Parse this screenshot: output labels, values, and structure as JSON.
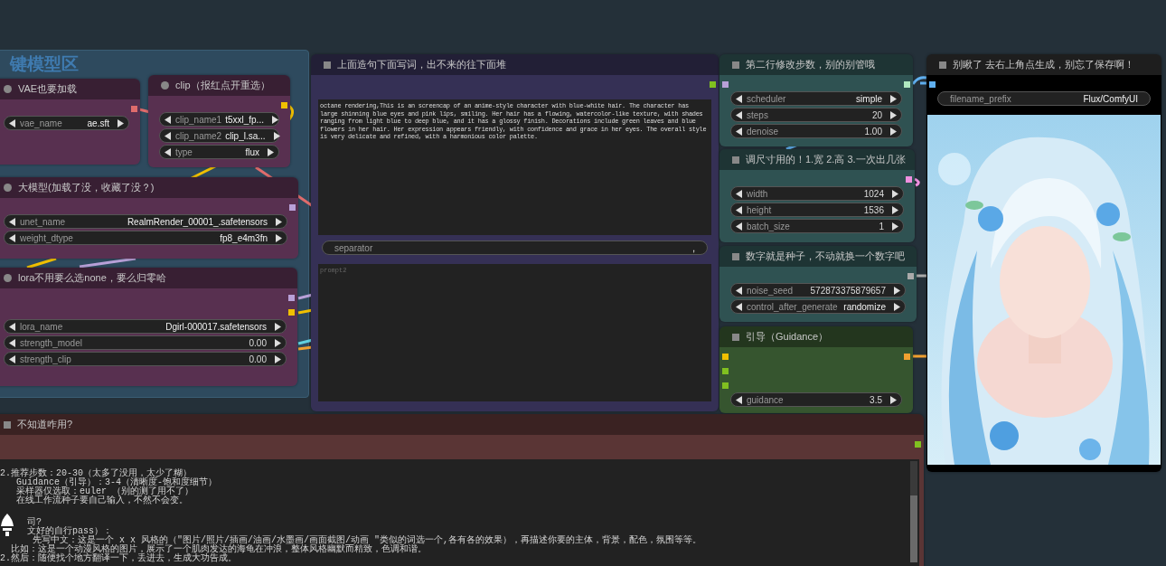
{
  "group": {
    "title": "键模型区"
  },
  "nodes": [
    {
      "kind": "widgets",
      "badge": {
        "kind": "dot"
      },
      "title": "VAE也要加载",
      "color": "#583050",
      "outputs": [
        {
          "color": "#e06c6c"
        }
      ],
      "widgets": [
        {
          "kind": "combo",
          "label": "vae_name",
          "value": "ae.sft"
        }
      ]
    },
    {
      "kind": "widgets",
      "badge": {
        "kind": "dot"
      },
      "title": "clip（报红点开重选）",
      "color": "#583050",
      "outputs": [
        {
          "color": "#f0c000"
        }
      ],
      "widgets": [
        {
          "kind": "combo",
          "label": "clip_name1",
          "value": "t5xxl_fp..."
        },
        {
          "kind": "combo",
          "label": "clip_name2",
          "value": "clip_l.sa..."
        },
        {
          "kind": "combo",
          "label": "type",
          "value": "flux"
        }
      ]
    },
    {
      "kind": "widgets",
      "badge": {
        "kind": "dot"
      },
      "title": "大模型(加载了没，收藏了没？)",
      "color": "#583050",
      "outputs": [
        {
          "color": "#b8a0d8"
        }
      ],
      "widgets": [
        {
          "kind": "combo",
          "label": "unet_name",
          "value": "RealmRender_00001_.safetensors"
        },
        {
          "kind": "combo",
          "label": "weight_dtype",
          "value": "fp8_e4m3fn"
        }
      ]
    },
    {
      "kind": "widgets",
      "badge": {
        "kind": "dot"
      },
      "title": "lora不用要么选none，要么归零哈",
      "color": "#583050",
      "outputs": [
        {
          "color": "#b8a0d8"
        },
        {
          "color": "#f0c000"
        }
      ],
      "widgets": [
        {
          "kind": "combo",
          "label": "lora_name",
          "value": "Dgirl-000017.safetensors"
        },
        {
          "kind": "number",
          "label": "strength_model",
          "value": "0.00"
        },
        {
          "kind": "number",
          "label": "strength_clip",
          "value": "0.00"
        }
      ]
    },
    {
      "kind": "prompt",
      "badge": {
        "kind": "square"
      },
      "title": "上面造句下面写词，出不来的往下面堆",
      "color": "#353055",
      "outputs": [
        {
          "color": "#80c020"
        }
      ],
      "text": "octane rendering,This is an screencap of an anime-style character with blue-white hair. The character has large shinning blue eyes and pink lips, smiling. Her hair has a flowing, watercolor-like texture, with shades ranging from light blue to deep blue, and it has a glossy finish. Decorations include green leaves and blue flowers in her hair. Her expression appears friendly, with confidence and grace in her eyes. The overall style is very delicate and refined, with a harmonious color palette.",
      "widgets": [
        {
          "kind": "text",
          "label": "separator",
          "value": ","
        }
      ],
      "placeholder": "prompt2"
    },
    {
      "kind": "widgets",
      "badge": {
        "kind": "square"
      },
      "title": "第二行修改步数，别的别管哦",
      "color": "#2f5252",
      "inputs": [
        {
          "color": "#b8a0d8"
        }
      ],
      "outputs": [
        {
          "color": "#b0e8c0"
        }
      ],
      "widgets": [
        {
          "kind": "combo",
          "label": "scheduler",
          "value": "simple"
        },
        {
          "kind": "number",
          "label": "steps",
          "value": "20"
        },
        {
          "kind": "number",
          "label": "denoise",
          "value": "1.00"
        }
      ]
    },
    {
      "kind": "widgets",
      "badge": {
        "kind": "square"
      },
      "title": "调尺寸用的！1.宽 2.高 3.一次出几张",
      "color": "#2f5252",
      "outputs": [
        {
          "color": "#f090e0"
        }
      ],
      "widgets": [
        {
          "kind": "number",
          "label": "width",
          "value": "1024"
        },
        {
          "kind": "number",
          "label": "height",
          "value": "1536"
        },
        {
          "kind": "number",
          "label": "batch_size",
          "value": "1"
        }
      ]
    },
    {
      "kind": "widgets",
      "badge": {
        "kind": "square"
      },
      "title": "数字就是种子，不动就换一个数字吧",
      "color": "#2f5252",
      "outputs": [
        {
          "color": "#aaaaaa"
        }
      ],
      "widgets": [
        {
          "kind": "number",
          "label": "noise_seed",
          "value": "572873375879657"
        },
        {
          "kind": "combo",
          "label": "control_after_generate",
          "value": "randomize"
        }
      ]
    },
    {
      "kind": "widgets",
      "badge": {
        "kind": "square"
      },
      "title": "引导（Guidance）",
      "color": "#36552f",
      "inputs": [
        {
          "color": "#f0c000"
        },
        {
          "color": "#80c020"
        },
        {
          "color": "#80c020"
        }
      ],
      "outputs": [
        {
          "color": "#f0a030"
        }
      ],
      "widgets": [
        {
          "kind": "number",
          "label": "guidance",
          "value": "3.5"
        }
      ]
    },
    {
      "kind": "save",
      "badge": {
        "kind": "square"
      },
      "title": "别瞅了 去右上角点生成，别忘了保存啊！",
      "color": "#000000",
      "inputs": [
        {
          "color": "#60b0f0"
        }
      ],
      "widgets": [
        {
          "kind": "text",
          "label": "filename_prefix",
          "value": "Flux/ComfyUI"
        }
      ],
      "image": {
        "kind": "picture"
      }
    },
    {
      "kind": "note",
      "badge": {
        "kind": "square"
      },
      "title": "不知道咋用?",
      "color": "#5a3535",
      "outputs": [
        {
          "color": "#80c020"
        }
      ],
      "paragraphs": [
        [
          "2.推荐步数：20-30（太多了没用，太少了糊）",
          "   Guidance（引导）：3-4（清晰度-饱和度细节）",
          "   采样器仅选取：euler （别的测了用不了）",
          "   在线工作流种子要自己输入，不然不会变。"
        ],
        [
          "     司?",
          "     文好的自行pass）：",
          "      先写中文：这是一个 x x 风格的（\"图片/照片/插画/油画/水墨画/画面截图/动画 \"类似的词选一个,各有各的效果），再描述你要的主体，背景，配色，氛围等等。",
          "  比如：这是一个动漫风格的图片，展示了一个肌肉发达的海龟在冲浪，整体风格幽默而精致，色调和谐。",
          "2.然后：随便找个地方翻译一下，丢进去，生成大功告成。"
        ]
      ]
    }
  ]
}
